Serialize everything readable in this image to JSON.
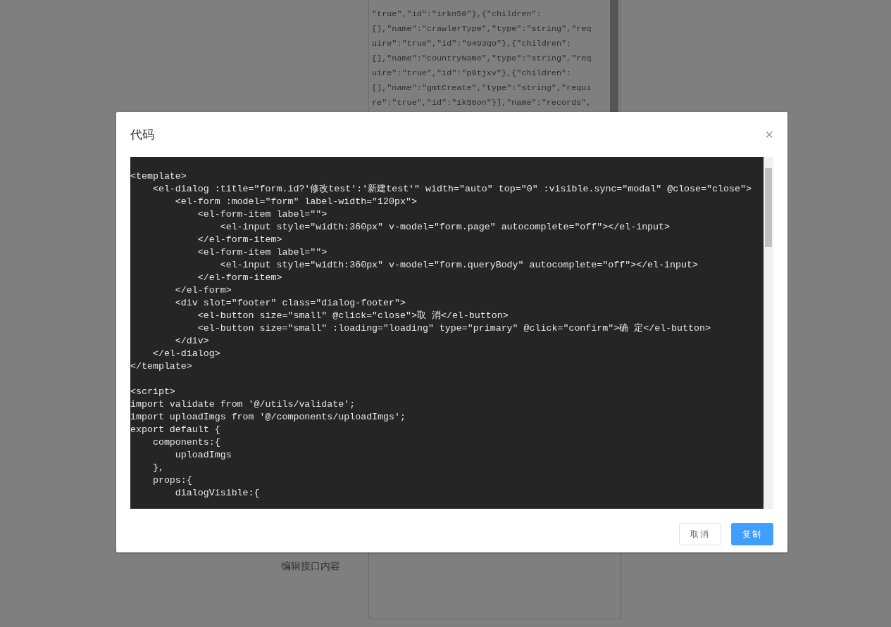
{
  "background": {
    "json_text_lines": [
      "\"true\",\"id\":\"irkn50\"},{\"children\":",
      "[],\"name\":\"crawlerType\",\"type\":\"string\",\"req",
      "uire\":\"true\",\"id\":\"9493qo\"},{\"children\":",
      "[],\"name\":\"countryName\",\"type\":\"string\",\"req",
      "uire\":\"true\",\"id\":\"p9tjxv\"},{\"children\":",
      "[],\"name\":\"gmtCreate\",\"type\":\"string\",\"requi",
      "re\":\"true\",\"id\":\"1k56on\"}],\"name\":\"records\","
    ],
    "field_label": "编辑接口内容"
  },
  "dialog": {
    "title": "代码",
    "close": "×",
    "code_blocks": [
      [
        "<template>",
        "    <el-dialog :title=\"form.id?'修改test':'新建test'\" width=\"auto\" top=\"0\" :visible.sync=\"modal\" @close=\"close\">",
        "        <el-form :model=\"form\" label-width=\"120px\">",
        "            <el-form-item label=\"\">",
        "                <el-input style=\"width:360px\" v-model=\"form.page\" autocomplete=\"off\"></el-input>",
        "            </el-form-item>",
        "            <el-form-item label=\"\">",
        "                <el-input style=\"width:360px\" v-model=\"form.queryBody\" autocomplete=\"off\"></el-input>",
        "            </el-form-item>",
        "        </el-form>",
        "        <div slot=\"footer\" class=\"dialog-footer\">",
        "            <el-button size=\"small\" @click=\"close\">取 消</el-button>",
        "            <el-button size=\"small\" :loading=\"loading\" type=\"primary\" @click=\"confirm\">确 定</el-button>",
        "        </div>",
        "    </el-dialog>",
        "</template>"
      ],
      [
        "<script>",
        "import validate from '@/utils/validate';",
        "import uploadImgs from '@/components/uploadImgs';",
        "export default {",
        "    components:{",
        "        uploadImgs",
        "    },",
        "    props:{",
        "        dialogVisible:{"
      ]
    ],
    "buttons": [
      {
        "label": "取消",
        "kind": "default"
      },
      {
        "label": "复制",
        "kind": "primary"
      }
    ]
  }
}
